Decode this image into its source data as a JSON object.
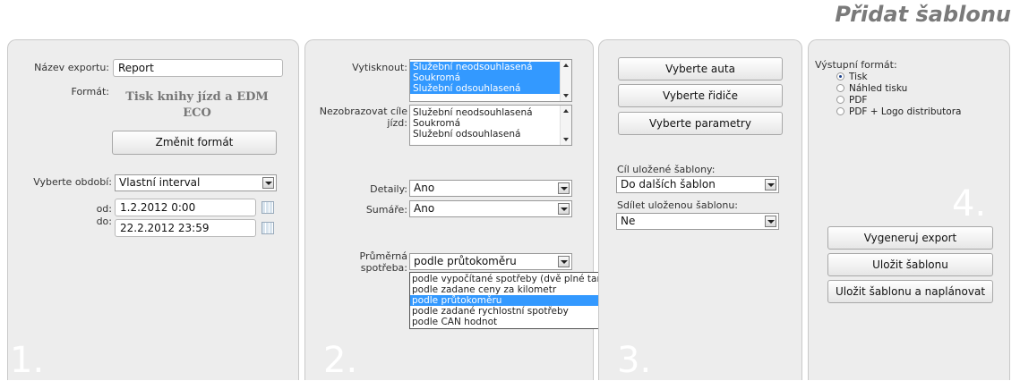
{
  "page_title": "Přidat šablonu",
  "panel1": {
    "step": "1.",
    "export_name_label": "Název exportu:",
    "export_name_value": "Report",
    "format_label": "Formát:",
    "format_name": "Tisk knihy jízd a EDM ECO",
    "change_format_button": "Změnit formát",
    "period_label": "Vyberte období:",
    "period_value": "Vlastní interval",
    "from_label": "od:",
    "from_value": "1.2.2012 0:00",
    "to_label": "do:",
    "to_value": "22.2.2012 23:59"
  },
  "panel2": {
    "step": "2.",
    "print_label": "Vytisknout:",
    "print_options": [
      "Služební neodsouhlasená",
      "Soukromá",
      "Služební odsouhlasená"
    ],
    "print_selected": [
      0,
      1,
      2
    ],
    "hide_label": "Nezobrazovat cíle jízd:",
    "hide_options": [
      "Služební neodsouhlasená",
      "Soukromá",
      "Služební odsouhlasená"
    ],
    "details_label": "Detaily:",
    "details_value": "Ano",
    "sums_label": "Sumáře:",
    "sums_value": "Ano",
    "consumption_label": "Průměrná spotřeba:",
    "consumption_value": "podle průtokoměru",
    "consumption_options": [
      "podle vypočítané spotřeby (dvě plné tankovani)",
      "podle zadane ceny za kilometr",
      "podle průtokoměru",
      "podle zadané rychlostní spotřeby",
      "podle CAN hodnot"
    ],
    "consumption_highlighted": 2
  },
  "panel3": {
    "step": "3.",
    "select_cars_button": "Vyberte auta",
    "select_drivers_button": "Vyberte řidiče",
    "select_params_button": "Vyberte parametry",
    "target_label": "Cíl uložené šablony:",
    "target_value": "Do dalších šablon",
    "share_label": "Sdílet uloženou šablonu:",
    "share_value": "Ne"
  },
  "panel4": {
    "step": "4.",
    "output_format_label": "Výstupní formát:",
    "output_options": [
      "Tisk",
      "Náhled tisku",
      "PDF",
      "PDF + Logo distributora"
    ],
    "output_selected": 0,
    "generate_button": "Vygeneruj export",
    "save_button": "Uložit šablonu",
    "save_schedule_button": "Uložit šablonu a naplánovat"
  },
  "colors": {
    "selection": "#3399ff",
    "panel": "#ededed",
    "step_number": "#ffffff",
    "title": "#7a7a7a"
  }
}
